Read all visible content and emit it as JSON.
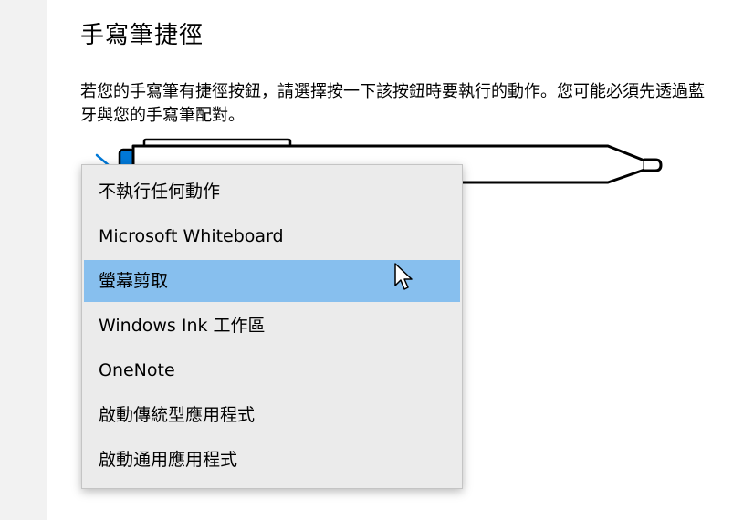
{
  "section": {
    "title": "手寫筆捷徑",
    "description": "若您的手寫筆有捷徑按鈕，請選擇按一下該按鈕時要執行的動作。您可能必須先透過藍牙與您的手寫筆配對。"
  },
  "dropdown": {
    "items": [
      {
        "label": "不執行任何動作"
      },
      {
        "label": "Microsoft Whiteboard"
      },
      {
        "label": "螢幕剪取"
      },
      {
        "label": "Windows Ink 工作區"
      },
      {
        "label": "OneNote"
      },
      {
        "label": "啟動傳統型應用程式"
      },
      {
        "label": "啟動通用應用程式"
      }
    ],
    "selected": "螢幕剪取"
  },
  "colors": {
    "selection": "#87bfee",
    "pen_button": "#0078d7",
    "menu_background": "#ebebeb"
  },
  "icons": {
    "pen": "pen-icon",
    "cursor": "mouse-pointer-icon"
  }
}
